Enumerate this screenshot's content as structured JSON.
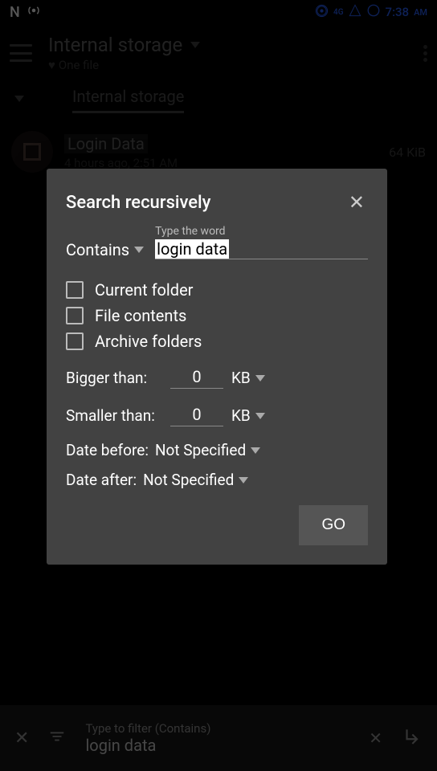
{
  "status_bar": {
    "left_text": "N",
    "time": "7:38",
    "time_suffix": "AM",
    "network": "4G"
  },
  "header": {
    "title": "Internal storage",
    "subtitle": "One file"
  },
  "breadcrumb": "Internal storage",
  "file": {
    "name": "Login Data",
    "meta": "4 hours ago, 2:51 AM",
    "size": "64 KiB"
  },
  "dialog": {
    "title": "Search recursively",
    "mode_label": "Contains",
    "input_label": "Type the word",
    "input_value": "login data",
    "checkboxes": {
      "current_folder": "Current folder",
      "file_contents": "File contents",
      "archive_folders": "Archive folders"
    },
    "bigger_than_label": "Bigger than:",
    "bigger_than_value": "0",
    "smaller_than_label": "Smaller than:",
    "smaller_than_value": "0",
    "unit": "KB",
    "date_before_label": "Date before:",
    "date_before_value": "Not Specified",
    "date_after_label": "Date after:",
    "date_after_value": "Not Specified",
    "go_label": "GO"
  },
  "bottom_bar": {
    "placeholder": "Type to filter (Contains)",
    "value": "login data"
  }
}
